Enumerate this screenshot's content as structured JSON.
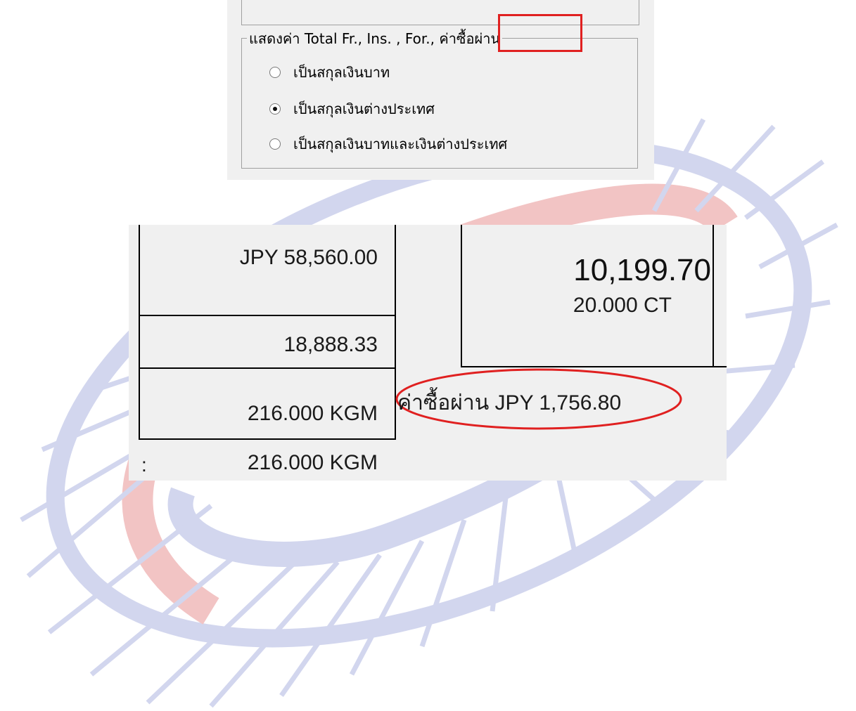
{
  "options_panel": {
    "legend_prefix": "แสดงค่า Total Fr., Ins. , For.,",
    "legend_highlight": "ค่าซื้อผ่าน",
    "radio_options": [
      {
        "label": "เป็นสกุลเงินบาท",
        "checked": false
      },
      {
        "label": "เป็นสกุลเงินต่างประเทศ",
        "checked": true
      },
      {
        "label": "เป็นสกุลเงินบาทและเงินต่างประเทศ",
        "checked": false
      }
    ]
  },
  "values_panel": {
    "amount_foreign": "JPY 58,560.00",
    "amount_baht": "18,888.33",
    "weight_cell": "216.000 KGM",
    "total_label": ":",
    "total_weight": "216.000 KGM",
    "big_amount": "10,199.70",
    "quantity": "20.000 CT",
    "purchase_fee": "ค่าซื้อผ่าน JPY 1,756.80"
  },
  "colors": {
    "highlight_red": "#e02020",
    "logo_red": "#f2c4c4",
    "logo_blue": "#d2d6ee",
    "panel_bg": "#f0f0f0"
  }
}
